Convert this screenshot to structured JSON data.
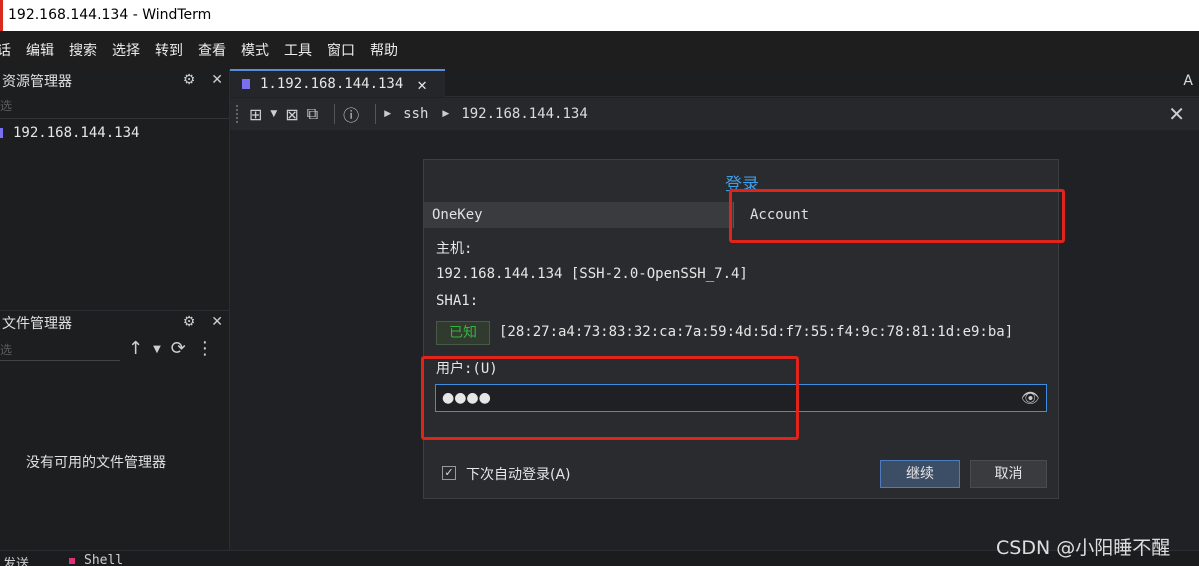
{
  "window": {
    "title": "192.168.144.134 - WindTerm"
  },
  "menu": [
    "话",
    "编辑",
    "搜索",
    "选择",
    "转到",
    "查看",
    "模式",
    "工具",
    "窗口",
    "帮助"
  ],
  "explorer": {
    "title": "资源管理器",
    "filter_placeholder": "选",
    "items": [
      "192.168.144.134"
    ]
  },
  "file_manager": {
    "title": "文件管理器",
    "filter_placeholder": "选",
    "empty_text": "没有可用的文件管理器"
  },
  "tabs": [
    {
      "label": "1.192.168.144.134",
      "close": "✕"
    }
  ],
  "tabstrip_right": "A",
  "toolbar": {
    "breadcrumb": [
      "ssh",
      "192.168.144.134"
    ]
  },
  "dialog": {
    "title": "登录",
    "tab_onekey": "OneKey",
    "tab_account": "Account",
    "host_label": "主机:",
    "host_value": "192.168.144.134 [SSH-2.0-OpenSSH_7.4]",
    "sha_label": "SHA1:",
    "known_badge": "已知",
    "sha_value": "[28:27:a4:73:83:32:ca:7a:59:4d:5d:f7:55:f4:9c:78:81:1d:e9:ba]",
    "user_label": "用户:(U)",
    "user_value": "●●●●",
    "auto_login_label": "下次自动登录(A)",
    "auto_login_checked": "✓",
    "continue_label": "继续",
    "cancel_label": "取消"
  },
  "statusbar": {
    "left": "发送",
    "shell": "Shell"
  },
  "watermark": "CSDN @小阳睡不醒",
  "colors": {
    "accent": "#3e9de8",
    "highlight_box": "#e0241b",
    "known_green": "#35b43c"
  }
}
